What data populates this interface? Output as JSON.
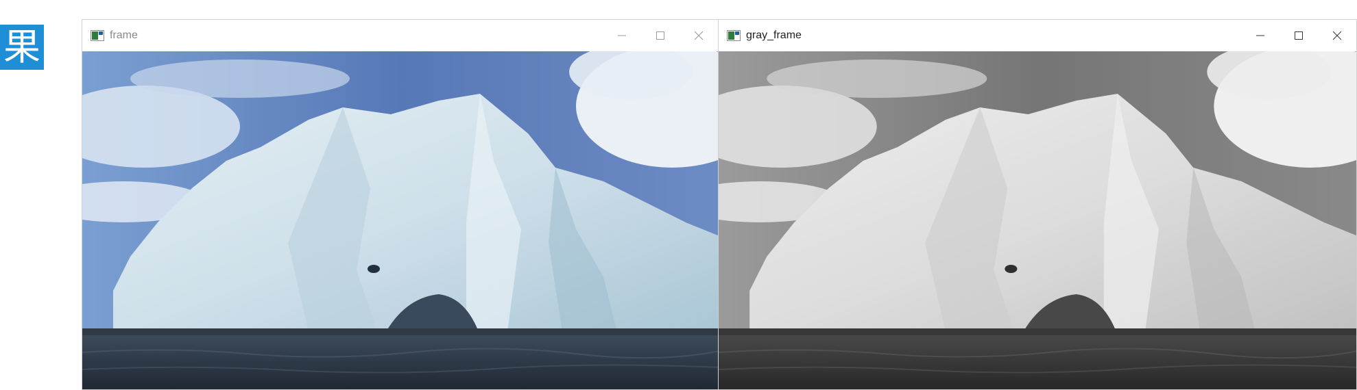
{
  "side_label": "果",
  "windows": [
    {
      "title": "frame",
      "icon": "opencv-window-icon",
      "controls": [
        "minimize-icon",
        "maximize-icon",
        "close-icon"
      ],
      "image": "iceberg color photo"
    },
    {
      "title": "gray_frame",
      "icon": "opencv-window-icon",
      "controls": [
        "minimize-icon",
        "maximize-icon",
        "close-icon"
      ],
      "image": "iceberg grayscale photo"
    }
  ],
  "colors": {
    "badge": "#1e8fd6",
    "sky": "#5d7fb8",
    "ice": "#cfe0ea",
    "water": "#2a3644"
  }
}
